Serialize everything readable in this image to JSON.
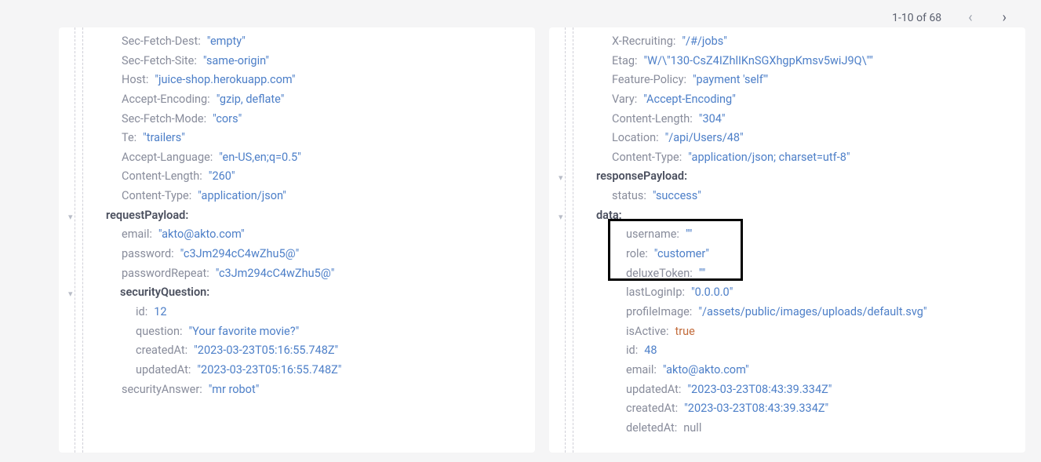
{
  "pagination": {
    "text": "1-10 of 68"
  },
  "left": {
    "headers": [
      {
        "k": "Sec-Fetch-Dest:",
        "v": "\"empty\""
      },
      {
        "k": "Sec-Fetch-Site:",
        "v": "\"same-origin\""
      },
      {
        "k": "Host:",
        "v": "\"juice-shop.herokuapp.com\""
      },
      {
        "k": "Accept-Encoding:",
        "v": "\"gzip, deflate\""
      },
      {
        "k": "Sec-Fetch-Mode:",
        "v": "\"cors\""
      },
      {
        "k": "Te:",
        "v": "\"trailers\""
      },
      {
        "k": "Accept-Language:",
        "v": "\"en-US,en;q=0.5\""
      },
      {
        "k": "Content-Length:",
        "v": "\"260\""
      },
      {
        "k": "Content-Type:",
        "v": "\"application/json\""
      }
    ],
    "requestPayloadLabel": "requestPayload:",
    "payload": [
      {
        "k": "email:",
        "v": "\"akto@akto.com\""
      },
      {
        "k": "password:",
        "v": "\"c3Jm294cC4wZhu5@\""
      },
      {
        "k": "passwordRepeat:",
        "v": "\"c3Jm294cC4wZhu5@\""
      }
    ],
    "securityQuestionLabel": "securityQuestion:",
    "securityQuestion": [
      {
        "k": "id:",
        "v": "12"
      },
      {
        "k": "question:",
        "v": "\"Your favorite movie?\""
      },
      {
        "k": "createdAt:",
        "v": "\"2023-03-23T05:16:55.748Z\""
      },
      {
        "k": "updatedAt:",
        "v": "\"2023-03-23T05:16:55.748Z\""
      }
    ],
    "securityAnswer": {
      "k": "securityAnswer:",
      "v": "\"mr robot\""
    }
  },
  "right": {
    "headers": [
      {
        "k": "X-Recruiting:",
        "v": "\"/#/jobs\""
      },
      {
        "k": "Etag:",
        "v": "\"W/\\\"130-CsZ4IZhlIKnSGXhgpKmsv5wiJ9Q\\\"\""
      },
      {
        "k": "Feature-Policy:",
        "v": "\"payment 'self'\""
      },
      {
        "k": "Vary:",
        "v": "\"Accept-Encoding\""
      },
      {
        "k": "Content-Length:",
        "v": "\"304\""
      },
      {
        "k": "Location:",
        "v": "\"/api/Users/48\""
      },
      {
        "k": "Content-Type:",
        "v": "\"application/json; charset=utf-8\""
      }
    ],
    "responsePayloadLabel": "responsePayload:",
    "status": {
      "k": "status:",
      "v": "\"success\""
    },
    "dataLabel": "data:",
    "data": [
      {
        "k": "username:",
        "v": "\"\""
      },
      {
        "k": "role:",
        "v": "\"customer\""
      },
      {
        "k": "deluxeToken:",
        "v": "\"\""
      },
      {
        "k": "lastLoginIp:",
        "v": "\"0.0.0.0\""
      },
      {
        "k": "profileImage:",
        "v": "\"/assets/public/images/uploads/default.svg\""
      },
      {
        "k": "isActive:",
        "v": "true",
        "cls": "bool"
      },
      {
        "k": "id:",
        "v": "48"
      },
      {
        "k": "email:",
        "v": "\"akto@akto.com\""
      },
      {
        "k": "updatedAt:",
        "v": "\"2023-03-23T08:43:39.334Z\""
      },
      {
        "k": "createdAt:",
        "v": "\"2023-03-23T08:43:39.334Z\""
      },
      {
        "k": "deletedAt:",
        "v": "null",
        "cls": "null"
      }
    ]
  }
}
